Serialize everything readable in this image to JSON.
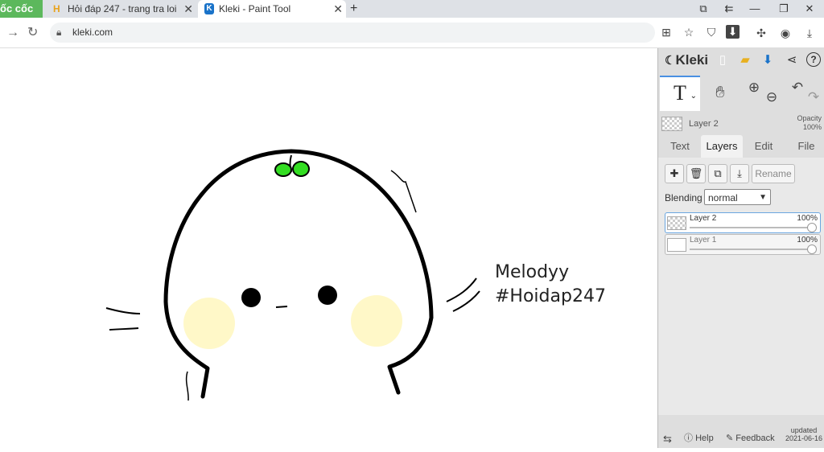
{
  "browser": {
    "brand": "ốc cốc",
    "tabs": [
      {
        "title": "Hỏi đáp 247 - trang tra loi",
        "favicon": "H",
        "close": "✕"
      },
      {
        "title": "Kleki - Paint Tool",
        "favicon": "K",
        "close": "✕"
      }
    ],
    "new_tab": "+",
    "url": "kleki.com"
  },
  "canvas": {
    "text_line1": "Melodyy",
    "text_line2": "#Hoidap247"
  },
  "panel": {
    "logo": "Kleki",
    "current_layer": "Layer 2",
    "opacity_label": "Opacity",
    "opacity_value": "100%",
    "tabs": [
      "Text",
      "Layers",
      "Edit",
      "File"
    ],
    "active_tab": "Layers",
    "rename_label": "Rename",
    "blending_label": "Blending",
    "blending_value": "normal",
    "layers": [
      {
        "name": "Layer 2",
        "opacity": "100%"
      },
      {
        "name": "Layer 1",
        "opacity": "100%"
      }
    ],
    "footer": {
      "help": "Help",
      "feedback": "Feedback",
      "updated": "updated",
      "updated_date": "2021-06-16"
    }
  },
  "colors": {
    "brand_green": "#5cb85c",
    "sprout_green": "#33dd22",
    "blush_yellow": "#fff8c8",
    "accent_blue": "#4a90e2"
  }
}
